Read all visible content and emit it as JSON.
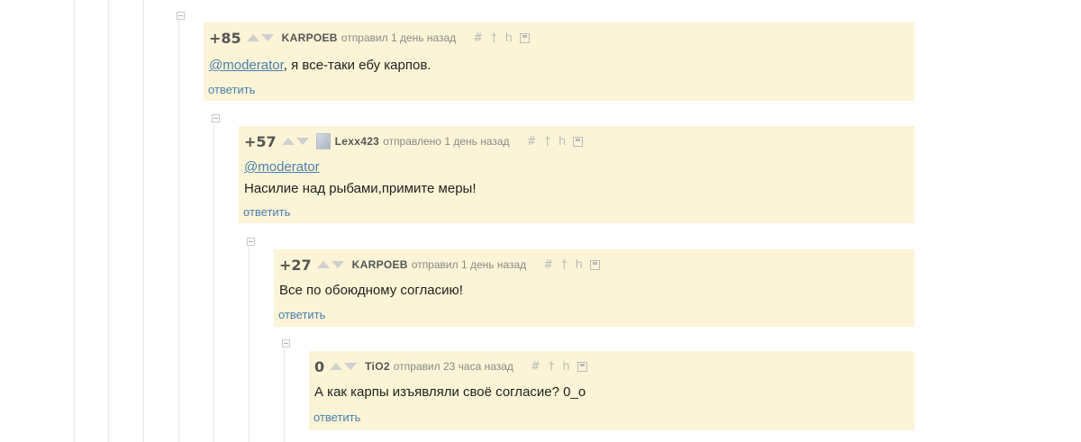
{
  "comments": [
    {
      "rating": "+85",
      "author": "KARPOEB",
      "time": "отправил 1 день назад",
      "mention": "@moderator",
      "text": ", я все-таки ебу карпов.",
      "reply": "ответить"
    },
    {
      "rating": "+57",
      "author": "Lexx423",
      "time": "отправлено 1 день назад",
      "mention": "@moderator",
      "text": "Насилие над рыбами,примите меры!",
      "reply": "ответить"
    },
    {
      "rating": "+27",
      "author": "KARPOEB",
      "time": "отправил 1 день назад",
      "text": "Все по обоюдному согласию!",
      "reply": "ответить"
    },
    {
      "rating": "0",
      "author": "TiO2",
      "time": "отправил 23 часа назад",
      "text": "А как карпы изъявляли своё согласие? 0_о",
      "reply": "ответить"
    }
  ],
  "tools": {
    "link": "#",
    "parent": "†",
    "thread": "h"
  },
  "icons": [
    "collapse-icon",
    "upvote-icon",
    "downvote-icon",
    "avatar-icon",
    "link-icon",
    "parent-icon",
    "thread-icon",
    "save-icon"
  ]
}
